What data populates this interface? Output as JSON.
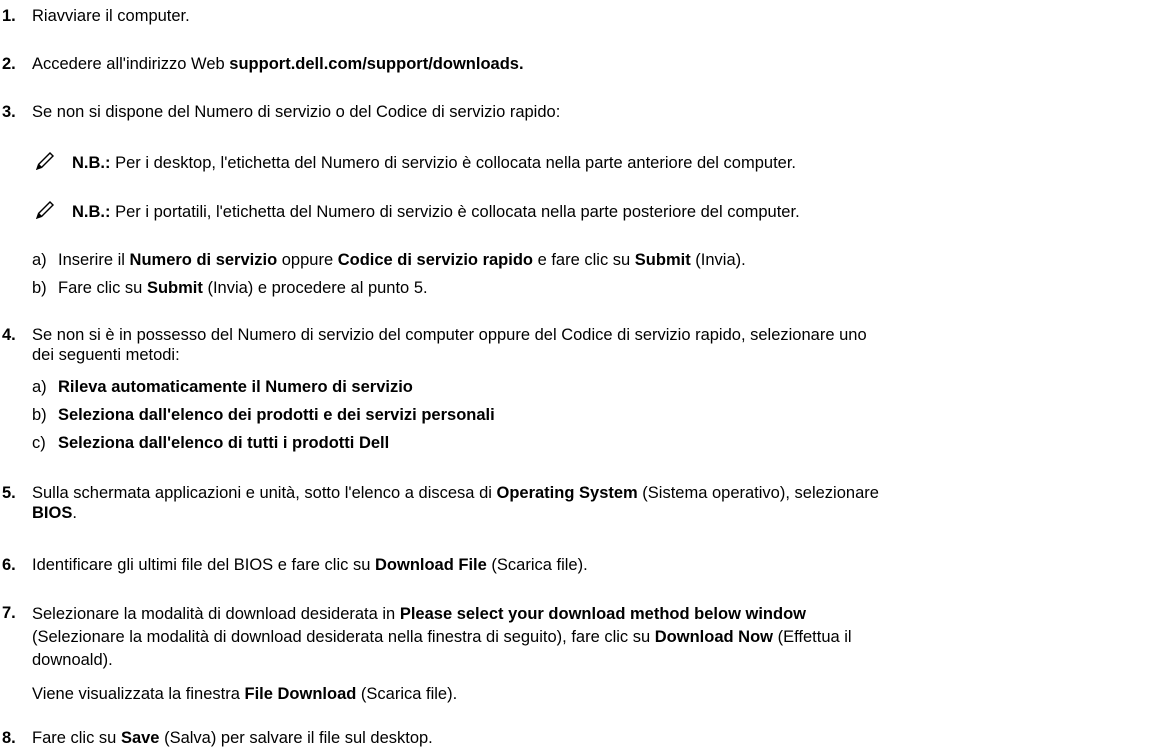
{
  "steps": {
    "s1": {
      "num": "1.",
      "text": "Riavviare il computer."
    },
    "s2": {
      "num": "2.",
      "pre": "Accedere all'indirizzo Web ",
      "bold": "support.dell.com/support/downloads."
    },
    "s3": {
      "num": "3.",
      "text": "Se non si dispone del Numero di servizio o del Codice di servizio rapido:"
    },
    "note1": {
      "label": "N.B.:",
      "text": " Per i desktop, l'etichetta del Numero di servizio è collocata nella parte anteriore del computer."
    },
    "note2": {
      "label": "N.B.:",
      "text": " Per i portatili, l'etichetta del Numero di servizio è collocata nella parte posteriore del computer."
    },
    "s3a": {
      "letter": "a)",
      "t1": "Inserire il ",
      "b1": "Numero di servizio",
      "t2": " oppure ",
      "b2": "Codice di servizio rapido",
      "t3": " e fare clic su ",
      "b3": "Submit",
      "t4": " (Invia)."
    },
    "s3b": {
      "letter": "b)",
      "t1": "Fare clic su ",
      "b1": "Submit",
      "t2": " (Invia) e procedere al punto 5."
    },
    "s4": {
      "num": "4.",
      "line1": "Se non si è in possesso del Numero di servizio del computer oppure del Codice di servizio rapido, selezionare uno",
      "line2": "dei seguenti metodi:"
    },
    "s4a": {
      "letter": "a)",
      "bold": "Rileva automaticamente il Numero di servizio"
    },
    "s4b": {
      "letter": "b)",
      "bold": "Seleziona dall'elenco dei prodotti e dei servizi personali"
    },
    "s4c": {
      "letter": "c)",
      "bold": "Seleziona dall'elenco di tutti i prodotti Dell"
    },
    "s5": {
      "num": "5.",
      "t1": "Sulla schermata applicazioni e unità, sotto l'elenco a discesa di ",
      "b1": "Operating System",
      "t2": " (Sistema operativo), selezionare",
      "b2": "BIOS",
      "t3": "."
    },
    "s6": {
      "num": "6.",
      "t1": "Identificare gli ultimi file del BIOS e fare clic su ",
      "b1": "Download File",
      "t2": " (Scarica file)."
    },
    "s7": {
      "num": "7.",
      "t1": "Selezionare la modalità di download desiderata in ",
      "b1": "Please select your download method below window",
      "t2": "(Selezionare la modalità di download desiderata nella finestra di seguito), fare clic su ",
      "b2": "Download Now",
      "t3": " (Effettua il",
      "t4": "downoald)."
    },
    "s7p": {
      "t1": "Viene visualizzata la finestra ",
      "b1": "File Download",
      "t2": " (Scarica file)."
    },
    "s8": {
      "num": "8.",
      "t1": "Fare clic su ",
      "b1": "Save",
      "t2": " (Salva) per salvare il file sul desktop."
    }
  }
}
